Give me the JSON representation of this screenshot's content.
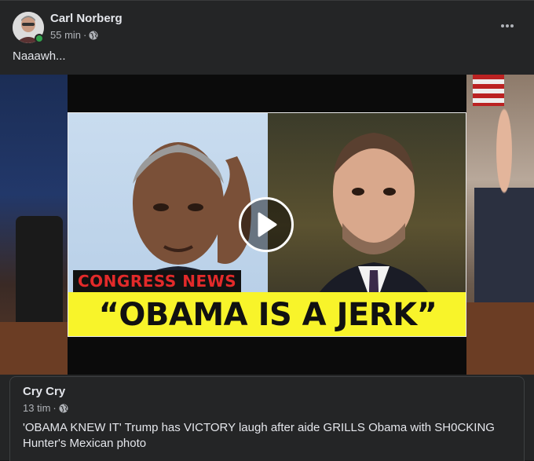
{
  "post": {
    "author": "Carl Norberg",
    "time": "55 min",
    "separator": "·",
    "privacy_icon": "globe-icon",
    "caption": "Naaawh...",
    "more_icon": "more-horizontal-icon",
    "online": true
  },
  "video": {
    "banner_label": "CONGRESS NEWS",
    "banner_main": "“OBAMA IS A JERK”",
    "play_icon": "play-icon"
  },
  "shared": {
    "author": "Cry Cry",
    "time": "13 tim",
    "separator": "·",
    "privacy_icon": "globe-icon",
    "text": "'OBAMA KNEW IT' Trump has VICTORY laugh after aide GRILLS Obama with SH0CKING Hunter's Mexican photo"
  },
  "colors": {
    "background": "#242526",
    "text_primary": "#e4e6eb",
    "text_secondary": "#b0b3b8",
    "online": "#31a24c",
    "banner_yellow": "#f8f42a",
    "banner_red": "#e22a2a"
  }
}
